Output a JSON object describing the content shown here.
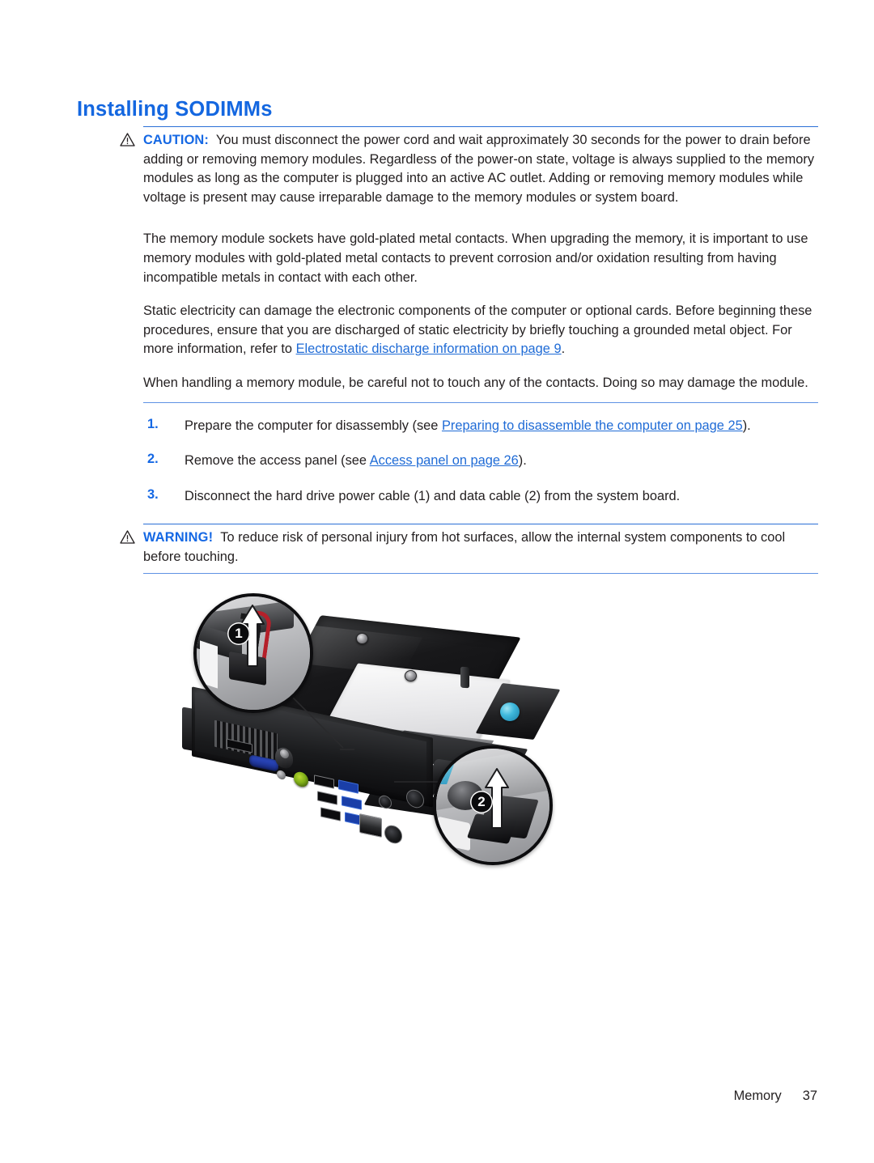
{
  "document": {
    "heading": "Installing SODIMMs",
    "accent_blue": "#1467e0",
    "link_blue": "#1f6bd6",
    "rule_blue": "#5f92e4",
    "text_color": "#231f20"
  },
  "caution": {
    "label": "CAUTION:",
    "icon": "warning-triangle-icon",
    "text": "You must disconnect the power cord and wait approximately 30 seconds for the power to drain before adding or removing memory modules. Regardless of the power-on state, voltage is always supplied to the memory modules as long as the computer is plugged into an active AC outlet. Adding or removing memory modules while voltage is present may cause irreparable damage to the memory modules or system board."
  },
  "paragraphs": {
    "gold_contacts": "The memory module sockets have gold-plated metal contacts. When upgrading the memory, it is important to use memory modules with gold-plated metal contacts to prevent corrosion and/or oxidation resulting from having incompatible metals in contact with each other.",
    "static_lead": "Static electricity can damage the electronic components of the computer or optional cards. Before beginning these procedures, ensure that you are discharged of static electricity by briefly touching a grounded metal object. For more information, refer to ",
    "static_link": "Electrostatic discharge information on page 9",
    "static_tail": ".",
    "handling": "When handling a memory module, be careful not to touch any of the contacts. Doing so may damage the module."
  },
  "steps": [
    {
      "number": "1.",
      "lead": "Prepare the computer for disassembly (see ",
      "link": "Preparing to disassemble the computer on page 25",
      "tail": ")."
    },
    {
      "number": "2.",
      "lead": "Remove the access panel (see ",
      "link": "Access panel on page 26",
      "tail": ")."
    },
    {
      "number": "3.",
      "lead": "Disconnect the hard drive power cable (1) and data cable (2) from the system board.",
      "link": "",
      "tail": ""
    }
  ],
  "warning": {
    "label": "WARNING!",
    "icon": "warning-triangle-icon",
    "text": "To reduce risk of personal injury from hot surfaces, allow the internal system components to cool before touching."
  },
  "figure": {
    "alt": "HP ultra-slim desktop computer with two magnified callouts showing the hard drive power cable and the data cable being disconnected",
    "callouts": [
      {
        "id": "1",
        "label": "1",
        "description": "hard-drive power cable pulled upward"
      },
      {
        "id": "2",
        "label": "2",
        "description": "hard-drive data cable pulled upward"
      }
    ]
  },
  "footer": {
    "section": "Memory",
    "page_number": "37"
  }
}
